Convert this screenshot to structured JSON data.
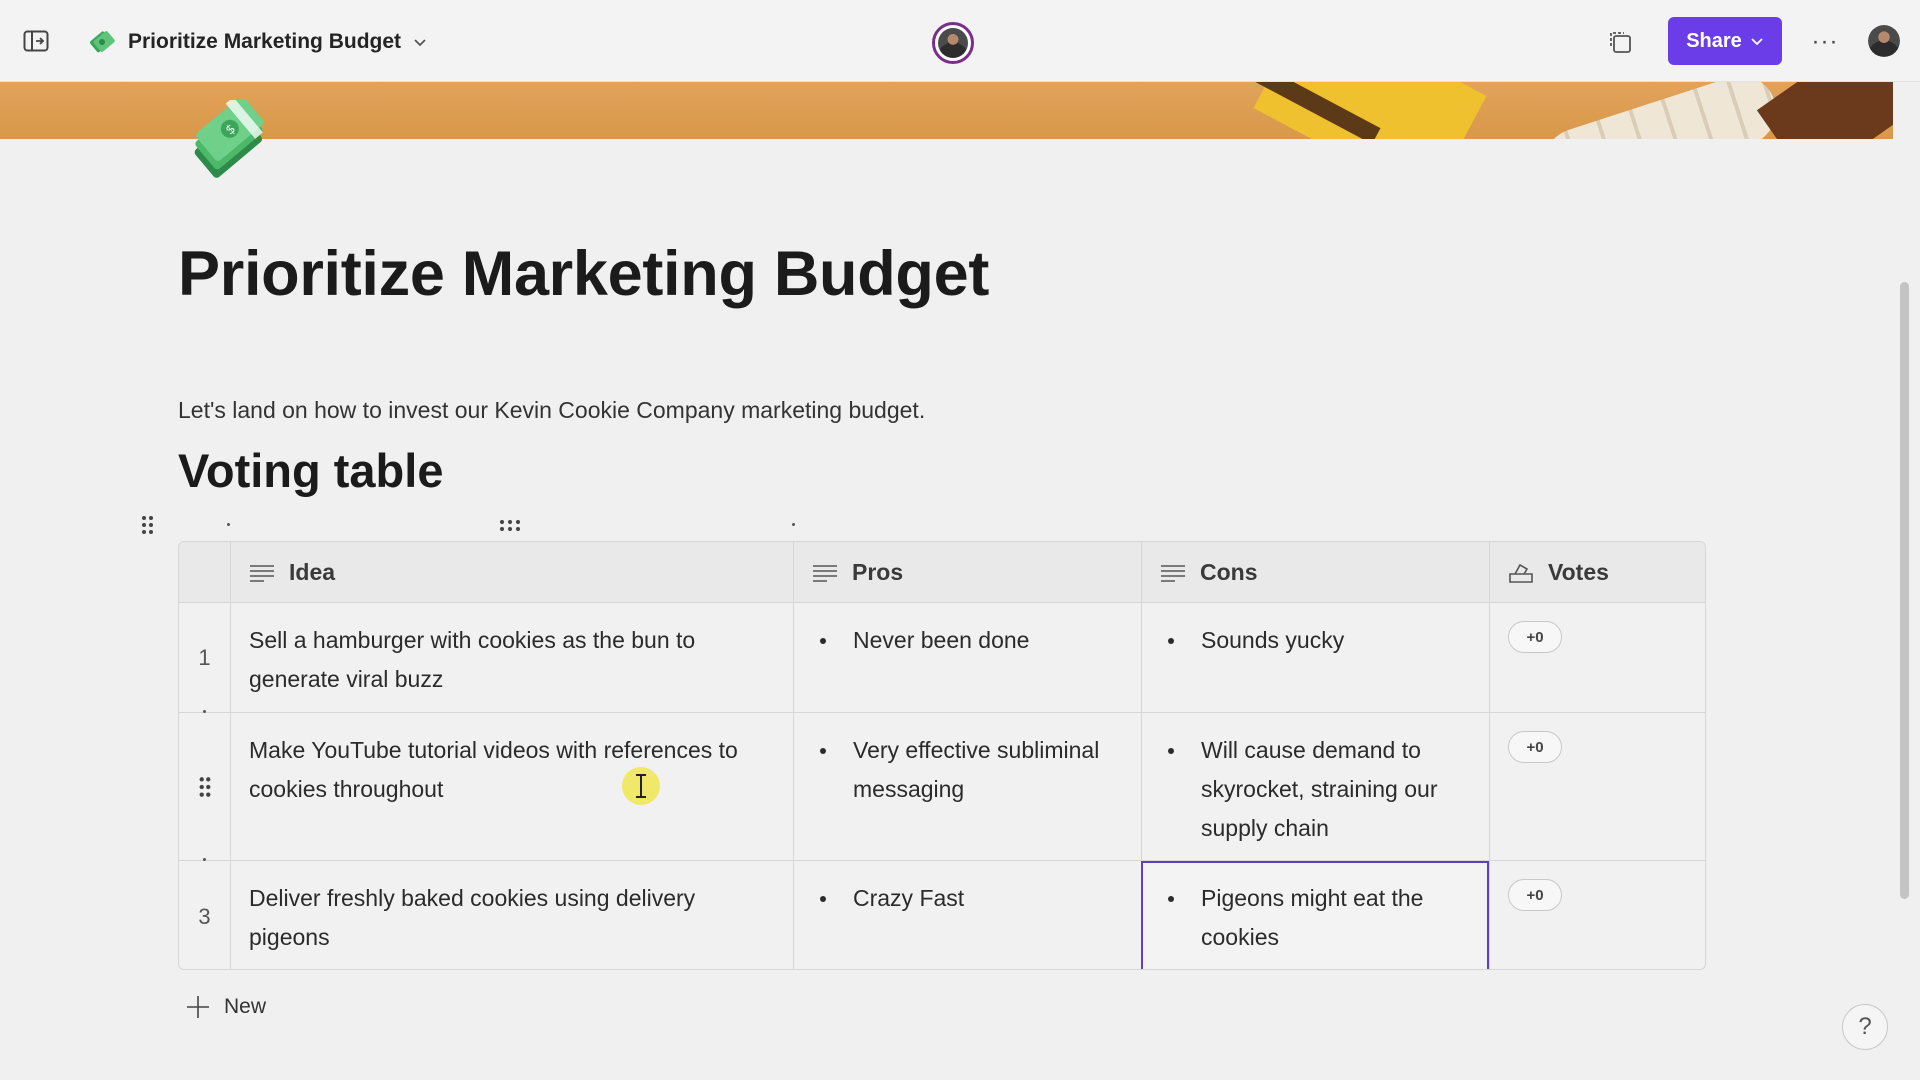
{
  "header": {
    "doc_title": "Prioritize Marketing Budget",
    "share_label": "Share",
    "more_label": "···"
  },
  "page": {
    "title": "Prioritize Marketing Budget",
    "description": "Let's land on how to invest our Kevin Cookie Company marketing budget.",
    "section_heading": "Voting table"
  },
  "table": {
    "columns": [
      {
        "label": "Idea",
        "icon": "text-lines-icon"
      },
      {
        "label": "Pros",
        "icon": "text-lines-icon"
      },
      {
        "label": "Cons",
        "icon": "text-lines-icon"
      },
      {
        "label": "Votes",
        "icon": "ballot-box-icon"
      }
    ],
    "rows": [
      {
        "number": "1",
        "idea": "Sell a hamburger with cookies as the bun to generate viral buzz",
        "pros": [
          "Never been done"
        ],
        "cons": [
          "Sounds yucky"
        ],
        "votes": "+0"
      },
      {
        "number": "",
        "idea": "Make YouTube tutorial videos with references to cookies throughout",
        "pros": [
          "Very effective subliminal messaging"
        ],
        "cons": [
          "Will cause demand to skyrocket, straining our supply chain"
        ],
        "votes": "+0"
      },
      {
        "number": "3",
        "idea": "Deliver freshly baked cookies using delivery pigeons",
        "pros": [
          "Crazy Fast"
        ],
        "cons": [
          "Pigeons might eat the cookies"
        ],
        "votes": "+0"
      }
    ],
    "new_label": "New"
  },
  "help_label": "?",
  "colors": {
    "accent": "#6a3de8",
    "selection": "#5b3fc7",
    "banner": "#dd9d50"
  }
}
